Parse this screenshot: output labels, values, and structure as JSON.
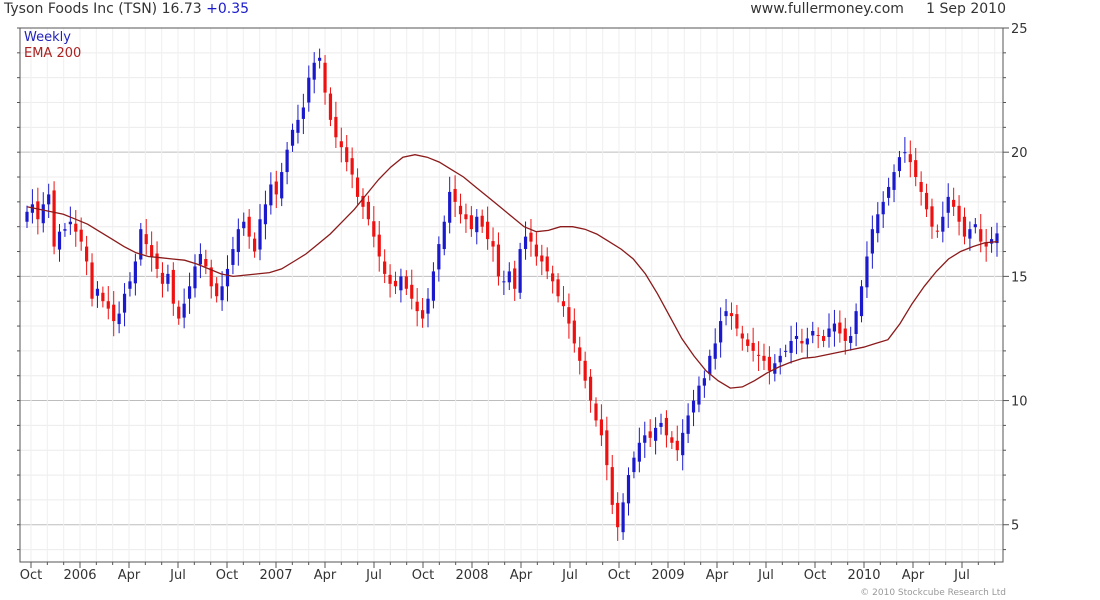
{
  "header": {
    "symbol": "Tyson Foods Inc (TSN)",
    "last": "16.73",
    "change": "+0.35",
    "site": "www.fullermoney.com",
    "date": "1 Sep 2010"
  },
  "legend": {
    "weekly": "Weekly",
    "ema": "EMA 200"
  },
  "copyright": "© 2010 Stockcube Research Ltd",
  "colors": {
    "up": "#1a1acc",
    "down": "#ee1111",
    "ema": "#8b1a1a",
    "grid": "#d8d8d8",
    "frame": "#555555"
  },
  "chart_data": {
    "type": "candlestick",
    "title": "Tyson Foods Inc (TSN)",
    "frequency": "Weekly",
    "ylim": [
      3.5,
      25
    ],
    "yticks": [
      5,
      10,
      15,
      20,
      25
    ],
    "x_tick_labels": [
      "Oct",
      "2006",
      "Apr",
      "Jul",
      "Oct",
      "2007",
      "Apr",
      "Jul",
      "Oct",
      "2008",
      "Apr",
      "Jul",
      "Oct",
      "2009",
      "Apr",
      "Jul",
      "Oct",
      "2010",
      "Apr",
      "Jul"
    ],
    "grid": true,
    "x_start": "2005-10",
    "close_series": [
      17.6,
      17.9,
      17.3,
      17.9,
      18.3,
      16.2,
      16.8,
      16.9,
      17.2,
      16.8,
      16.4,
      15.6,
      14.1,
      14.5,
      14.0,
      13.7,
      13.2,
      13.5,
      14.3,
      14.8,
      15.6,
      16.9,
      16.3,
      15.8,
      15.3,
      14.7,
      15.1,
      13.9,
      13.3,
      13.9,
      14.6,
      15.4,
      15.9,
      15.4,
      14.6,
      14.2,
      14.6,
      15.3,
      16.1,
      16.9,
      17.2,
      16.6,
      16.0,
      17.3,
      17.9,
      18.7,
      18.3,
      19.2,
      20.1,
      20.9,
      21.3,
      21.8,
      23.0,
      23.6,
      23.8,
      22.4,
      21.3,
      20.6,
      20.2,
      19.6,
      19.1,
      18.2,
      17.8,
      17.3,
      16.6,
      15.8,
      15.1,
      14.7,
      14.6,
      15.0,
      14.5,
      14.1,
      13.6,
      13.3,
      14.1,
      15.2,
      16.3,
      17.2,
      18.4,
      18.0,
      17.5,
      17.3,
      16.9,
      17.4,
      17.0,
      16.5,
      16.2,
      15.0,
      14.8,
      15.2,
      14.5,
      16.1,
      16.6,
      16.4,
      15.8,
      15.6,
      15.2,
      14.8,
      14.2,
      13.8,
      13.1,
      12.3,
      11.6,
      10.8,
      10.0,
      9.2,
      8.6,
      7.4,
      5.8,
      4.9,
      5.9,
      7.0,
      7.7,
      8.3,
      8.6,
      8.5,
      8.9,
      9.1,
      8.6,
      8.3,
      8.0,
      8.7,
      9.4,
      10.0,
      10.6,
      10.9,
      11.8,
      12.3,
      13.2,
      13.6,
      13.4,
      12.9,
      12.5,
      12.2,
      12.0,
      11.8,
      11.6,
      11.2,
      11.5,
      11.8,
      12.0,
      12.4,
      12.6,
      12.3,
      12.5,
      12.8,
      12.6,
      12.4,
      12.9,
      13.1,
      12.7,
      12.4,
      12.6,
      13.6,
      14.6,
      15.8,
      16.9,
      17.5,
      18.0,
      18.6,
      19.2,
      19.8,
      20.0,
      19.6,
      19.0,
      18.4,
      17.7,
      17.0,
      16.8,
      17.4,
      18.2,
      17.8,
      17.2,
      16.6,
      16.9,
      17.1,
      16.4,
      16.2,
      16.5,
      16.73
    ],
    "ema200_series": [
      17.8,
      17.7,
      17.6,
      17.5,
      17.3,
      17.1,
      16.8,
      16.5,
      16.2,
      15.95,
      15.8,
      15.75,
      15.7,
      15.65,
      15.5,
      15.3,
      15.1,
      15.0,
      15.05,
      15.1,
      15.15,
      15.3,
      15.6,
      15.9,
      16.3,
      16.7,
      17.2,
      17.7,
      18.3,
      18.9,
      19.4,
      19.8,
      19.9,
      19.8,
      19.6,
      19.3,
      19.0,
      18.6,
      18.2,
      17.8,
      17.4,
      17.0,
      16.8,
      16.85,
      17.0,
      17.0,
      16.9,
      16.7,
      16.4,
      16.1,
      15.7,
      15.1,
      14.3,
      13.4,
      12.5,
      11.8,
      11.2,
      10.8,
      10.5,
      10.55,
      10.8,
      11.1,
      11.35,
      11.55,
      11.7,
      11.75,
      11.85,
      11.95,
      12.05,
      12.15,
      12.3,
      12.45,
      13.1,
      13.9,
      14.6,
      15.2,
      15.7,
      16.0,
      16.2,
      16.35,
      16.4
    ]
  }
}
